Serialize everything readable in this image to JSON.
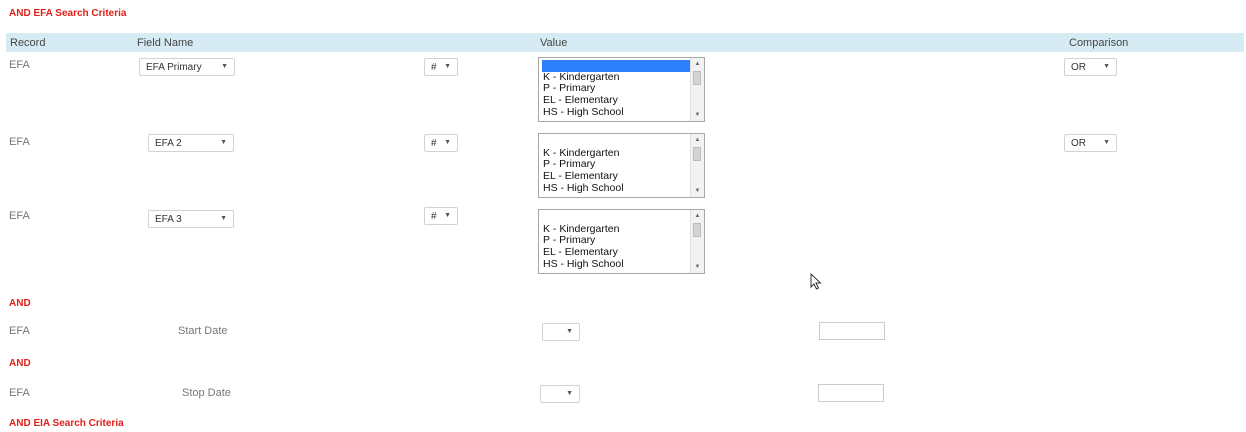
{
  "sections": {
    "efa_title": "AND EFA Search Criteria",
    "eia_title": "AND EIA Search Criteria"
  },
  "headers": {
    "record": "Record",
    "field_name": "Field Name",
    "value": "Value",
    "comparison": "Comparison"
  },
  "rows": [
    {
      "record": "EFA",
      "field": "EFA Primary",
      "operator": "#",
      "comparison": "OR"
    },
    {
      "record": "EFA",
      "field": "EFA 2",
      "operator": "#",
      "comparison": "OR"
    },
    {
      "record": "EFA",
      "field": "EFA 3",
      "operator": "#"
    }
  ],
  "list_options": [
    "",
    "K - Kindergarten",
    "P - Primary",
    "EL - Elementary",
    "HS - High School"
  ],
  "and_label": "AND",
  "date_rows": [
    {
      "record": "EFA",
      "label": "Start Date"
    },
    {
      "record": "EFA",
      "label": "Stop Date"
    }
  ],
  "colors": {
    "accent_red": "#e0201a",
    "header_bg": "#d6ebf3",
    "selected_blue": "#2d7ff9"
  }
}
